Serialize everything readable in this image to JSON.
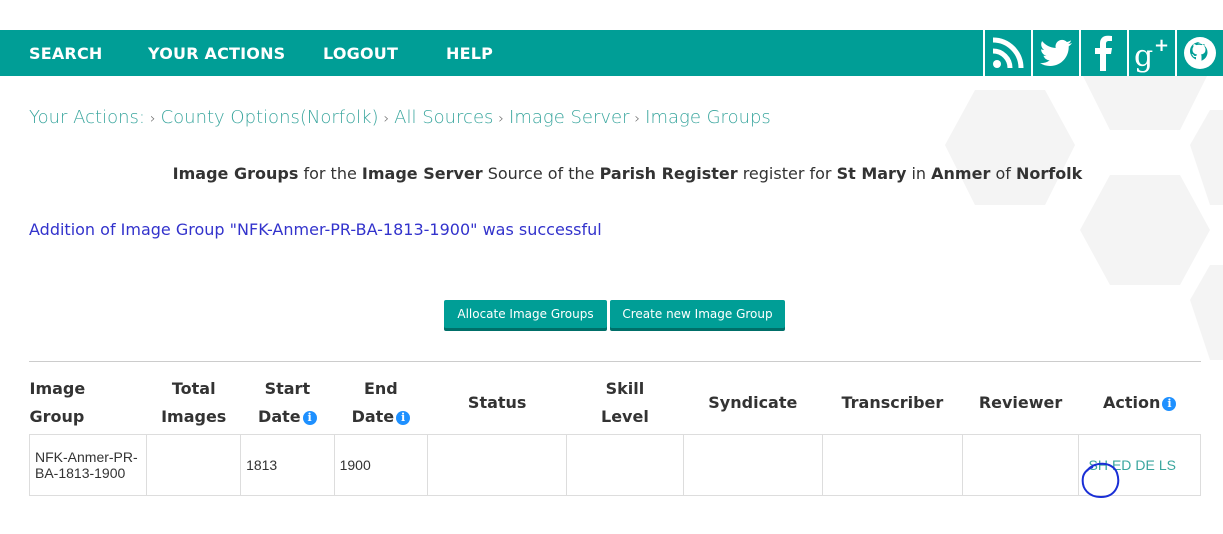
{
  "nav": {
    "items": [
      "SEARCH",
      "YOUR ACTIONS",
      "LOGOUT",
      "HELP"
    ],
    "social_icons": [
      "rss-icon",
      "twitter-icon",
      "facebook-icon",
      "google-plus-icon",
      "github-icon"
    ],
    "bg_color": "#009e96"
  },
  "breadcrumb": {
    "prefix": "Your Actions:",
    "items": [
      "County Options(Norfolk)",
      "All Sources",
      "Image Server",
      "Image Groups"
    ]
  },
  "heading": {
    "b1": "Image Groups",
    "t1": "for the",
    "b2": "Image Server",
    "t2": "Source of the",
    "b3": "Parish Register",
    "t3": "register for",
    "b4": "St Mary",
    "t4": "in",
    "b5": "Anmer",
    "t5": "of",
    "b6": "Norfolk"
  },
  "message": "Addition of Image Group \"NFK-Anmer-PR-BA-1813-1900\" was successful",
  "buttons": {
    "allocate": "Allocate Image Groups",
    "create": "Create new Image Group"
  },
  "table": {
    "headers": {
      "image_group": "Image Group",
      "total_images_1": "Total",
      "total_images_2": "Images",
      "start_date_1": "Start",
      "start_date_2": "Date",
      "end_date_1": "End",
      "end_date_2": "Date",
      "status": "Status",
      "skill_level_1": "Skill",
      "skill_level_2": "Level",
      "syndicate": "Syndicate",
      "transcriber": "Transcriber",
      "reviewer": "Reviewer",
      "action": "Action"
    },
    "rows": [
      {
        "image_group": "NFK-Anmer-PR-BA-1813-1900",
        "total_images": "",
        "start_date": "1813",
        "end_date": "1900",
        "status": "",
        "skill_level": "",
        "syndicate": "",
        "transcriber": "",
        "reviewer": "",
        "actions": [
          "SH",
          "ED",
          "DE",
          "LS"
        ]
      }
    ]
  },
  "colors": {
    "accent": "#009e96",
    "link": "#3aa69e",
    "message": "#3333cc",
    "info_icon": "#1e90ff",
    "annotation": "#1a2fd6"
  }
}
